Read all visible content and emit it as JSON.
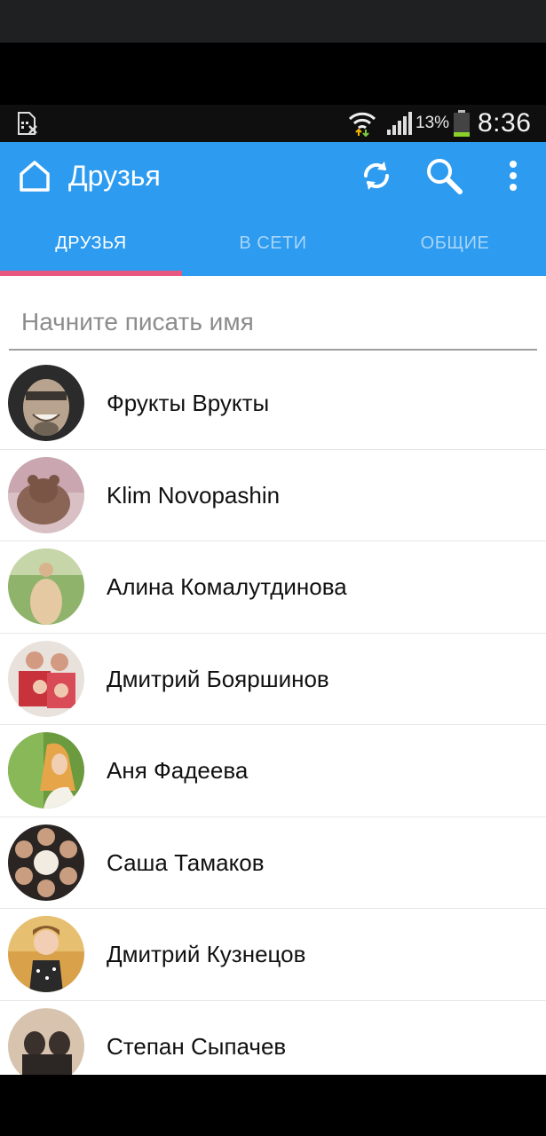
{
  "status_bar": {
    "battery_percent": "13%",
    "time": "8:36"
  },
  "app_bar": {
    "title": "Друзья",
    "icons": [
      "home-icon",
      "refresh-icon",
      "search-icon",
      "more-vert-icon"
    ],
    "accent_color": "#2c9bf0"
  },
  "tabs": [
    {
      "label": "ДРУЗЬЯ",
      "active": true
    },
    {
      "label": "В СЕТИ",
      "active": false
    },
    {
      "label": "ОБЩИЕ",
      "active": false
    }
  ],
  "tab_indicator_color": "#e8577f",
  "search": {
    "placeholder": "Начните писать имя",
    "value": ""
  },
  "friends": [
    {
      "name": "Фрукты Врукты"
    },
    {
      "name": "Klim Novopashin"
    },
    {
      "name": "Алина Комалутдинова"
    },
    {
      "name": "Дмитрий Бояршинов"
    },
    {
      "name": "Аня Фадеева"
    },
    {
      "name": "Саша Тамаков"
    },
    {
      "name": "Дмитрий Кузнецов"
    },
    {
      "name": "Степан Сыпачев"
    }
  ]
}
